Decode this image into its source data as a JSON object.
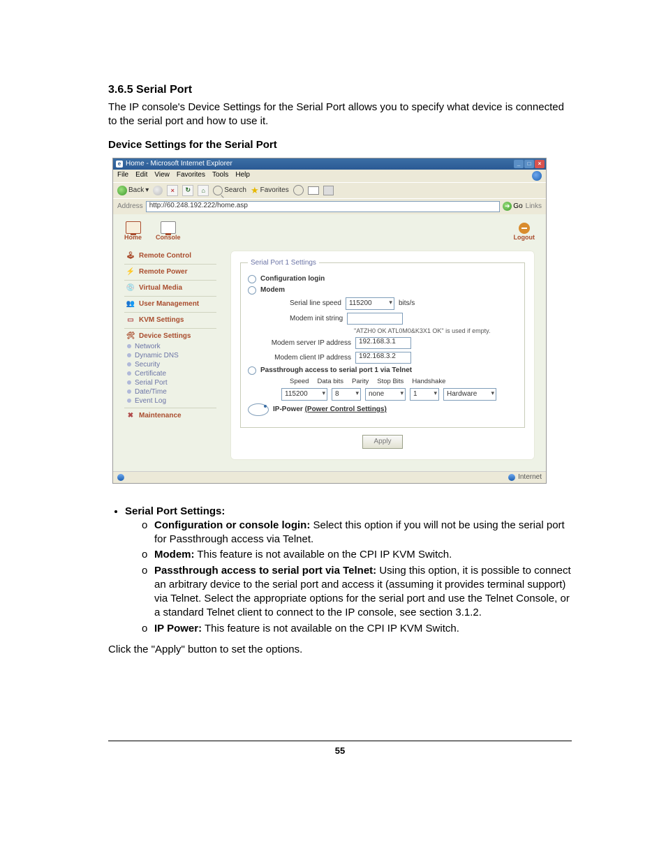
{
  "doc": {
    "heading": "3.6.5 Serial Port",
    "intro": "The IP console's Device Settings for the Serial Port allows you to specify what device is connected to the serial port and how to use it.",
    "subhead": "Device Settings for the Serial Port",
    "bullet_title": "Serial Port Settings:",
    "b1_label": "Configuration or console login:",
    "b1_text": " Select this option if you will not be using the serial port for Passthrough access via Telnet.",
    "b2_label": "Modem:",
    "b2_text": " This feature is not available on the CPI IP KVM Switch.",
    "b3_label": "Passthrough access to serial port via Telnet:",
    "b3_text": " Using this option, it is possible to connect an arbitrary device to the serial port and access it (assuming it provides terminal support) via Telnet. Select the appropriate options for the serial port and use the Telnet Console, or a standard Telnet client to connect to the IP console, see section 3.1.2.",
    "b4_label": "IP Power:",
    "b4_text": " This feature is not available on the CPI IP KVM Switch.",
    "closing": "Click the \"Apply\" button to set the options.",
    "page_number": "55"
  },
  "ie": {
    "title": "Home - Microsoft Internet Explorer",
    "menu": {
      "file": "File",
      "edit": "Edit",
      "view": "View",
      "favorites": "Favorites",
      "tools": "Tools",
      "help": "Help"
    },
    "toolbar": {
      "back": "Back",
      "search": "Search",
      "favorites": "Favorites"
    },
    "address_label": "Address",
    "address_value": "http://60.248.192.222/home.asp",
    "go": "Go",
    "links": "Links",
    "status_zone": "Internet"
  },
  "app": {
    "top": {
      "home": "Home",
      "console": "Console",
      "logout": "Logout"
    },
    "nav": {
      "remote_control": "Remote Control",
      "remote_power": "Remote Power",
      "virtual_media": "Virtual Media",
      "user_management": "User Management",
      "kvm_settings": "KVM Settings",
      "device_settings": "Device Settings",
      "network": "Network",
      "dynamic_dns": "Dynamic DNS",
      "security": "Security",
      "certificate": "Certificate",
      "serial_port": "Serial Port",
      "date_time": "Date/Time",
      "event_log": "Event Log",
      "maintenance": "Maintenance"
    },
    "form": {
      "legend": "Serial Port 1 Settings",
      "cfg_login": "Configuration login",
      "modem": "Modem",
      "serial_speed_label": "Serial line speed",
      "serial_speed_value": "115200",
      "serial_speed_unit": "bits/s",
      "init_label": "Modem init string",
      "init_value": "",
      "init_note": "\"ATZH0 OK ATL0M0&K3X1 OK\" is used if empty.",
      "server_ip_label": "Modem server IP address",
      "server_ip_value": "192.168.3.1",
      "client_ip_label": "Modem client IP address",
      "client_ip_value": "192.168.3.2",
      "pass_label": "Passthrough access to serial port 1 via Telnet",
      "hdr_speed": "Speed",
      "hdr_databits": "Data bits",
      "hdr_parity": "Parity",
      "hdr_stopbits": "Stop Bits",
      "hdr_handshake": "Handshake",
      "v_speed": "115200",
      "v_databits": "8",
      "v_parity": "none",
      "v_stopbits": "1",
      "v_handshake": "Hardware",
      "ippower1": "IP-Power ",
      "ippower2": "(Power Control Settings)",
      "apply": "Apply"
    }
  }
}
